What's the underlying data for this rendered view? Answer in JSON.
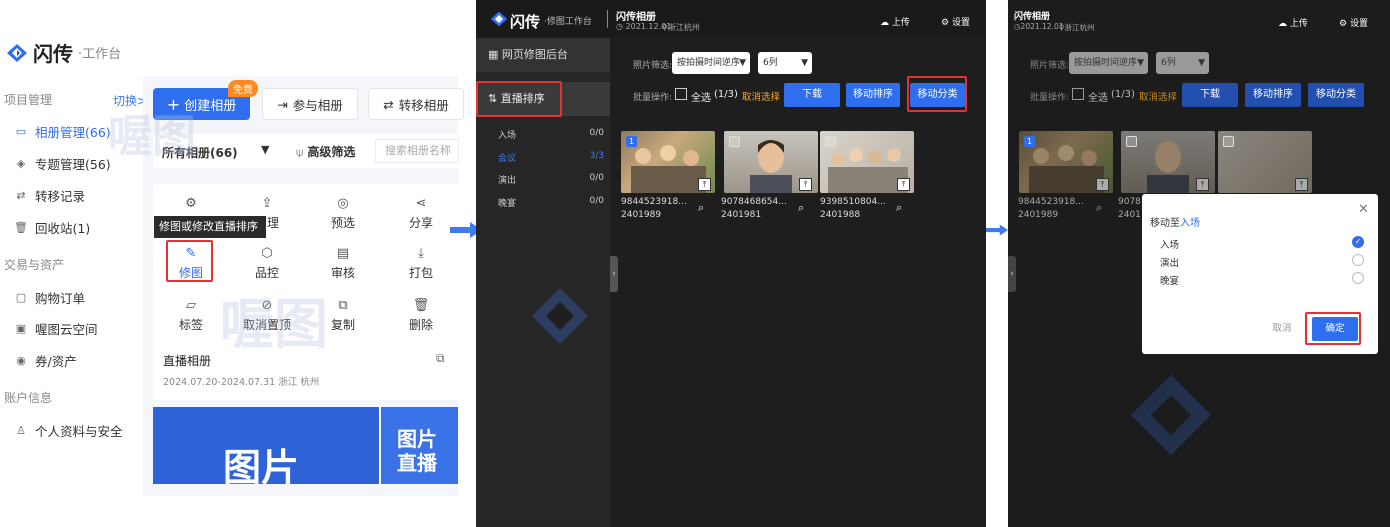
{
  "panel1": {
    "brand": "闪传",
    "brand_sub": "·工作台",
    "section_project": "项目管理",
    "switch_label": "切换>",
    "nav": [
      {
        "label": "相册管理(66)",
        "icon": "album-icon"
      },
      {
        "label": "专题管理(56)",
        "icon": "layers-icon"
      },
      {
        "label": "转移记录",
        "icon": "transfer-icon"
      },
      {
        "label": "回收站(1)",
        "icon": "trash-icon"
      }
    ],
    "section_trade": "交易与资产",
    "nav_trade": [
      {
        "label": "购物订单",
        "icon": "order-icon"
      },
      {
        "label": "喔图云空间",
        "icon": "cloud-space-icon"
      },
      {
        "label": "券/资产",
        "icon": "coupon-icon"
      }
    ],
    "section_account": "账户信息",
    "nav_account": [
      {
        "label": "个人资料与安全",
        "icon": "user-icon"
      }
    ],
    "create_album": "创建相册",
    "free_badge": "免费",
    "join_album": "参与相册",
    "transfer_album": "转移相册",
    "all_albums": "所有相册(66)",
    "advanced_filter": "高级筛选",
    "search_placeholder": "搜索相册名称",
    "ops_row1": [
      "设置",
      "管理",
      "预选",
      "分享"
    ],
    "ops_row2": [
      "修图",
      "品控",
      "审核",
      "打包"
    ],
    "ops_row3": [
      "标签",
      "取消置顶",
      "复制",
      "删除"
    ],
    "tooltip": "修图或修改直播排序",
    "live_album_title": "直播相册",
    "live_album_meta": "2024.07.20-2024.07.31 浙江 杭州",
    "banner_big": "图片",
    "banner_side_1": "图片",
    "banner_side_2": "直播",
    "watermark": "喔图"
  },
  "panel2": {
    "brand": "闪传",
    "brand_sub": "·修图工作台",
    "album_title": "闪传相册",
    "album_date": "2021.12.01",
    "album_loc": "浙江杭州",
    "upload": "上传",
    "settings": "设置",
    "menu_backend": "网页修图后台",
    "menu_live_sort": "直播排序",
    "categories": [
      {
        "name": "入场",
        "count": "0/0"
      },
      {
        "name": "会议",
        "count": "3/3"
      },
      {
        "name": "演出",
        "count": "0/0"
      },
      {
        "name": "晚宴",
        "count": "0/0"
      }
    ],
    "filter_label": "照片筛选:",
    "sort_select": "按拍摄时间逆序",
    "cols_select": "6列",
    "batch_label": "批量操作:",
    "select_all": "全选",
    "select_count": "(1/3)",
    "cancel_select": "取消选择",
    "btn_download": "下载",
    "btn_move_sort": "移动排序",
    "btn_move_cat": "移动分类",
    "photos": [
      {
        "name1": "9844523918...",
        "name2": "2401989"
      },
      {
        "name1": "9078468654...",
        "name2": "2401981"
      },
      {
        "name1": "9398510804...",
        "name2": "2401988"
      }
    ]
  },
  "panel3": {
    "album_title": "闪传相册",
    "album_date": "2021.12.01",
    "album_loc": "浙江杭州",
    "upload": "上传",
    "settings": "设置",
    "filter_label": "照片筛选:",
    "sort_select": "按拍摄时间逆序",
    "cols_select": "6列",
    "batch_label": "批量操作:",
    "select_all": "全选",
    "select_count": "(1/3)",
    "cancel_select": "取消选择",
    "btn_download": "下载",
    "btn_move_sort": "移动排序",
    "btn_move_cat": "移动分类",
    "photos": [
      {
        "name1": "9844523918...",
        "name2": "2401989"
      },
      {
        "name1": "9078",
        "name2": "2401"
      }
    ],
    "modal_title_prefix": "移动至",
    "modal_title_target": "入场",
    "modal_options": [
      "入场",
      "演出",
      "晚宴"
    ],
    "modal_cancel": "取消",
    "modal_confirm": "确定"
  },
  "colors": {
    "accent": "#2f6fef",
    "highlight_box": "#e23333",
    "badge": "#ff8a1f"
  }
}
